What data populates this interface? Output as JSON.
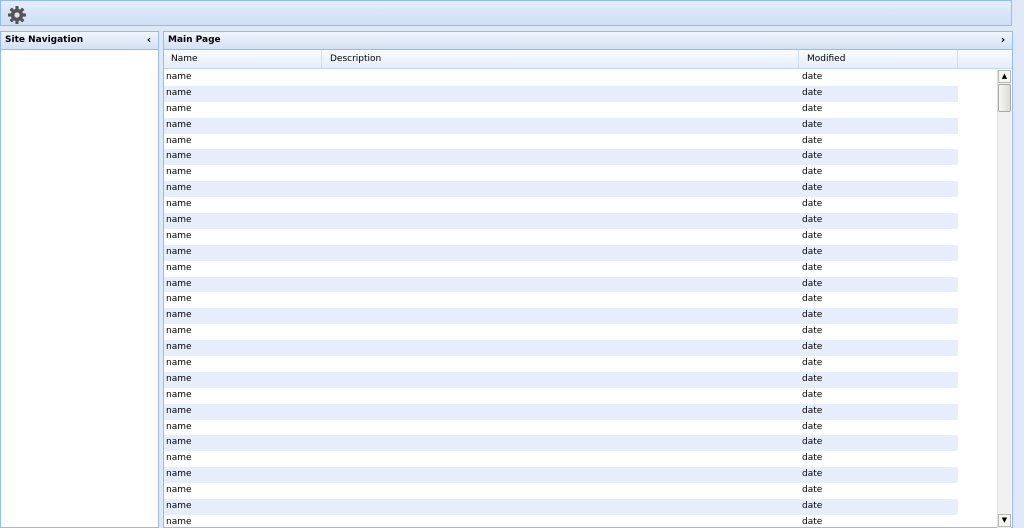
{
  "toolbar": {
    "icon": "gear-icon"
  },
  "nav_panel": {
    "title": "Site Navigation",
    "collapse_glyph": "‹"
  },
  "main_panel": {
    "title": "Main Page",
    "expand_glyph": "›"
  },
  "grid": {
    "columns": [
      {
        "key": "name",
        "label": "Name"
      },
      {
        "key": "description",
        "label": "Description"
      },
      {
        "key": "modified",
        "label": "Modified"
      }
    ],
    "rows": [
      {
        "name": "name",
        "description": "",
        "modified": "date"
      },
      {
        "name": "name",
        "description": "",
        "modified": "date"
      },
      {
        "name": "name",
        "description": "",
        "modified": "date"
      },
      {
        "name": "name",
        "description": "",
        "modified": "date"
      },
      {
        "name": "name",
        "description": "",
        "modified": "date"
      },
      {
        "name": "name",
        "description": "",
        "modified": "date"
      },
      {
        "name": "name",
        "description": "",
        "modified": "date"
      },
      {
        "name": "name",
        "description": "",
        "modified": "date"
      },
      {
        "name": "name",
        "description": "",
        "modified": "date"
      },
      {
        "name": "name",
        "description": "",
        "modified": "date"
      },
      {
        "name": "name",
        "description": "",
        "modified": "date"
      },
      {
        "name": "name",
        "description": "",
        "modified": "date"
      },
      {
        "name": "name",
        "description": "",
        "modified": "date"
      },
      {
        "name": "name",
        "description": "",
        "modified": "date"
      },
      {
        "name": "name",
        "description": "",
        "modified": "date"
      },
      {
        "name": "name",
        "description": "",
        "modified": "date"
      },
      {
        "name": "name",
        "description": "",
        "modified": "date"
      },
      {
        "name": "name",
        "description": "",
        "modified": "date"
      },
      {
        "name": "name",
        "description": "",
        "modified": "date"
      },
      {
        "name": "name",
        "description": "",
        "modified": "date"
      },
      {
        "name": "name",
        "description": "",
        "modified": "date"
      },
      {
        "name": "name",
        "description": "",
        "modified": "date"
      },
      {
        "name": "name",
        "description": "",
        "modified": "date"
      },
      {
        "name": "name",
        "description": "",
        "modified": "date"
      },
      {
        "name": "name",
        "description": "",
        "modified": "date"
      },
      {
        "name": "name",
        "description": "",
        "modified": "date"
      },
      {
        "name": "name",
        "description": "",
        "modified": "date"
      },
      {
        "name": "name",
        "description": "",
        "modified": "date"
      },
      {
        "name": "name",
        "description": "",
        "modified": "date"
      }
    ]
  },
  "scrollbar": {
    "up_glyph": "▲",
    "down_glyph": "▼"
  }
}
